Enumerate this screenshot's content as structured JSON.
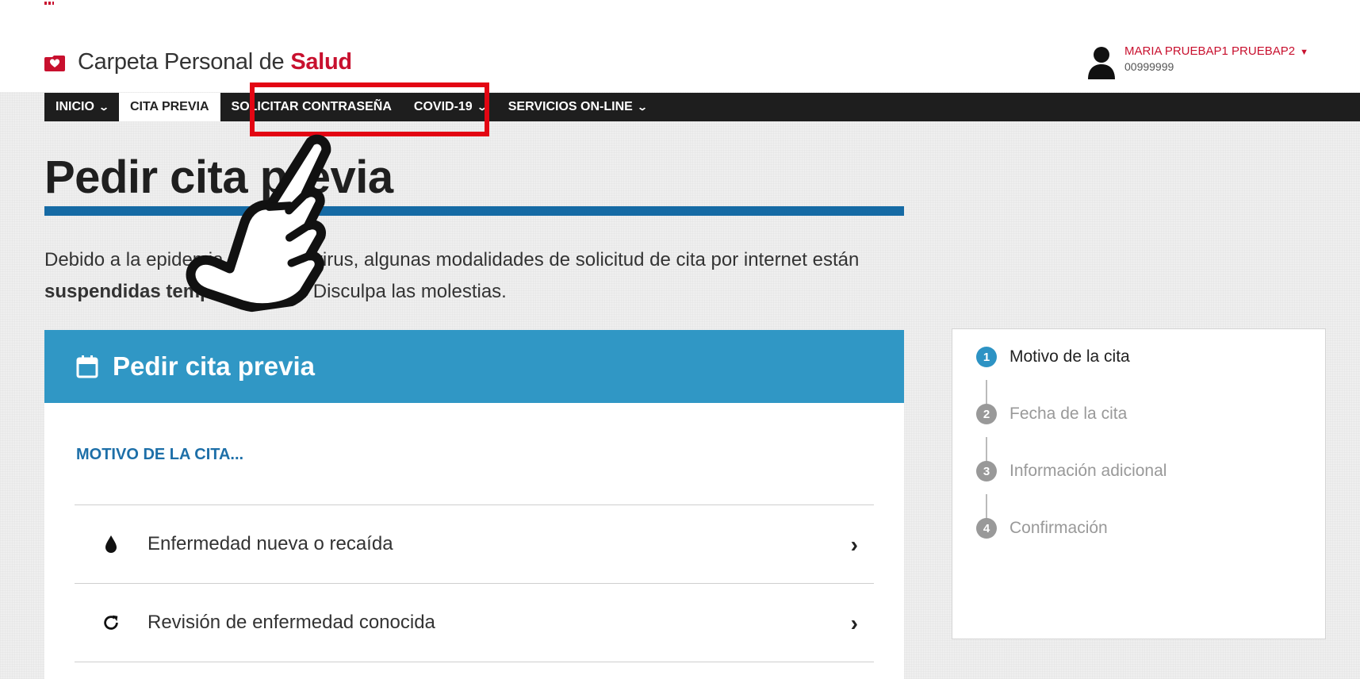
{
  "app": {
    "title_prefix": "Carpeta Personal de",
    "title_brand": "Salud"
  },
  "user": {
    "name": "MARIA PRUEBAP1 PRUEBAP2",
    "id": "00999999"
  },
  "nav": {
    "items": [
      {
        "label": "INICIO",
        "has_dropdown": true
      },
      {
        "label": "CITA PREVIA",
        "active": true
      },
      {
        "label": "SOLICITAR CONTRASEÑA"
      },
      {
        "label": "COVID-19",
        "has_dropdown": true
      },
      {
        "label": "SERVICIOS ON-LINE",
        "has_dropdown": true
      }
    ]
  },
  "page": {
    "title": "Pedir cita previa",
    "notice_part1": "Debido a la epidemia de coronavirus, algunas modalidades de solicitud de cita por internet están ",
    "notice_bold": "suspendidas temporalmente",
    "notice_part2": ". Disculpa las molestias."
  },
  "panel": {
    "title": "Pedir cita previa",
    "label": "MOTIVO DE LA CITA...",
    "items": [
      {
        "label": "Enfermedad nueva o recaída",
        "icon": "drop-icon"
      },
      {
        "label": "Revisión de enfermedad conocida",
        "icon": "refresh-icon"
      }
    ]
  },
  "steps": [
    {
      "num": "1",
      "label": "Motivo de la cita",
      "active": true
    },
    {
      "num": "2",
      "label": "Fecha de la cita"
    },
    {
      "num": "3",
      "label": "Información adicional"
    },
    {
      "num": "4",
      "label": "Confirmación"
    }
  ],
  "colors": {
    "brand_red": "#c8102e",
    "nav_bg": "#1e1e1e",
    "panel_blue": "#3097c5",
    "title_rule": "#156aa4",
    "highlight_red": "#e30613"
  }
}
